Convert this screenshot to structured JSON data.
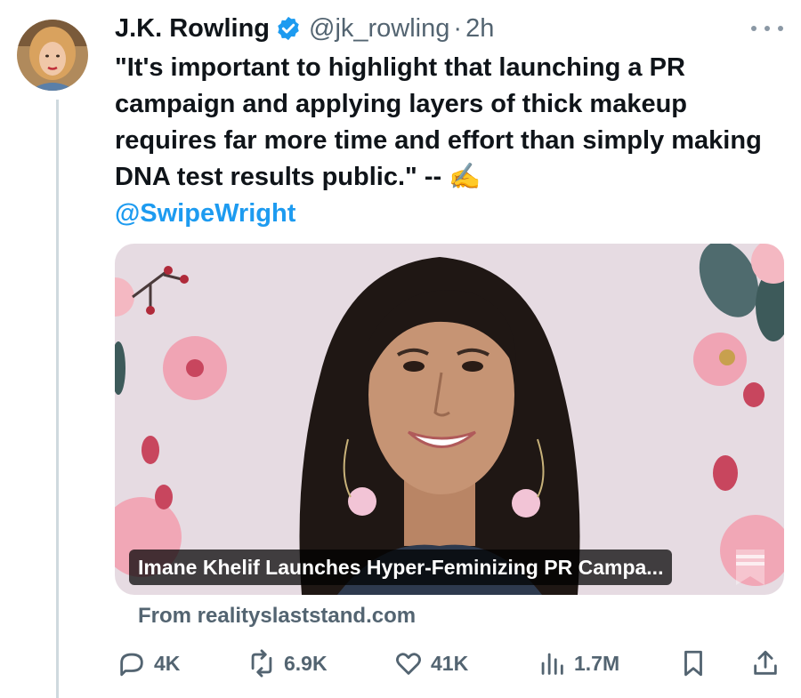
{
  "author": {
    "display_name": "J.K. Rowling",
    "handle": "@jk_rowling",
    "separator": "·",
    "time": "2h",
    "verified_icon": "verified-badge-icon",
    "verified_color": "#1d9bf0"
  },
  "tweet": {
    "text_main": "\"It's important to highlight that launching a PR campaign and applying layers of thick makeup requires far more time and effort than simply making DNA test results public.\" --",
    "emoji": "✍️",
    "mention": "@SwipeWright"
  },
  "card": {
    "title": "Imane Khelif Launches Hyper-Feminizing PR Campa...",
    "source": "From realityslaststand.com"
  },
  "actions": {
    "reply_count": "4K",
    "retweet_count": "6.9K",
    "like_count": "41K",
    "views_count": "1.7M"
  },
  "colors": {
    "link": "#1d9bf0",
    "muted": "#536471",
    "text": "#0f1419",
    "thread_line": "#cfd9de"
  }
}
